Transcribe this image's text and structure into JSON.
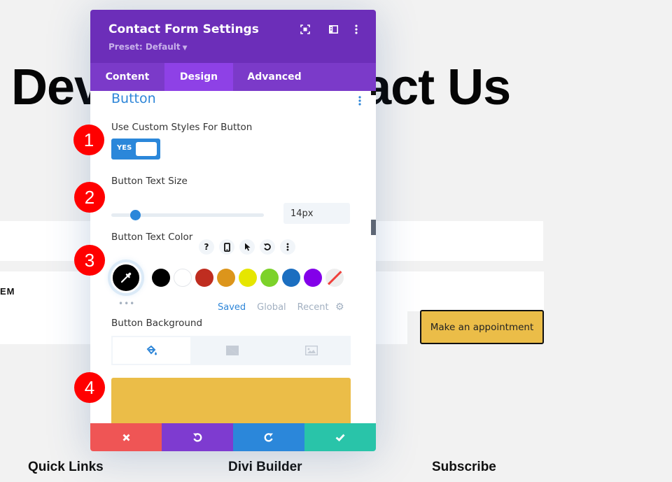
{
  "page": {
    "heading": "Devi Contact Us",
    "heading_left": "Dev",
    "heading_right": "act Us",
    "form_field_partial_text": "EM",
    "appointment_button": "Make an appointment",
    "footer_headings": [
      "Quick Links",
      "Divi Builder",
      "Subscribe"
    ]
  },
  "modal": {
    "title": "Contact Form Settings",
    "preset": "Preset: Default",
    "header_icons": [
      "focus-mode-icon",
      "split-view-icon",
      "more-options-icon"
    ],
    "tabs": [
      {
        "label": "Content",
        "active": false
      },
      {
        "label": "Design",
        "active": true
      },
      {
        "label": "Advanced",
        "active": false
      }
    ],
    "section_title": "Button",
    "fields": {
      "custom_styles": {
        "label": "Use Custom Styles For Button",
        "toggle_label": "YES",
        "enabled": true
      },
      "text_size": {
        "label": "Button Text Size",
        "value": "14px",
        "slider_fraction": 0.14
      },
      "text_color": {
        "label": "Button Text Color",
        "option_icons": [
          "?",
          "phone",
          "cursor",
          "reset",
          "more"
        ],
        "current_color": "#000000",
        "swatches": [
          "#000000",
          "#ffffff",
          "#bf2d20",
          "#dc951b",
          "#e6e600",
          "#7cd22a",
          "#1b6ec0",
          "#8300e9",
          "none"
        ],
        "palette_tabs": [
          "Saved",
          "Global",
          "Recent"
        ],
        "active_palette_tab": "Saved"
      },
      "background": {
        "label": "Button Background",
        "tab_icons": [
          "paint-bucket-icon",
          "gradient-icon",
          "image-icon"
        ],
        "color": "#ebbd48"
      }
    },
    "footer_buttons": [
      "cancel",
      "undo",
      "redo",
      "save"
    ]
  },
  "markers": [
    "1",
    "2",
    "3",
    "4"
  ],
  "colors": {
    "header_purple": "#6c2eb9",
    "tab_bar": "#7b3ac9",
    "active_tab": "#8e41e6",
    "accent_blue": "#2b87da",
    "cancel_red": "#ef5555",
    "save_green": "#29c4a9",
    "marker_red": "#ff0000"
  }
}
